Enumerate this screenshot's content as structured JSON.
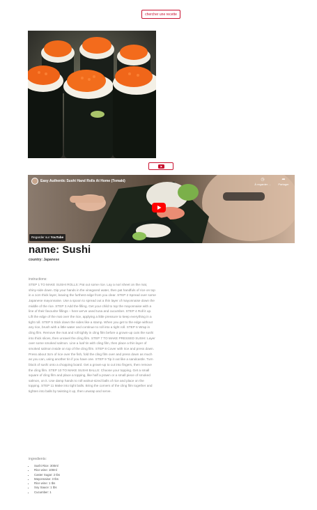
{
  "search_button": {
    "label": "chercher une recette"
  },
  "photo": {
    "alt": "Sushi"
  },
  "video": {
    "title": "Easy Authentic Sushi Hand Rolls At Home (Temaki)",
    "watch_later": "À regarder ...",
    "share": "Partager",
    "watch_on": "Regarder sur",
    "platform": "YouTube"
  },
  "recipe": {
    "name": "name: Sushi",
    "country": "country: Japanese",
    "instructions_label": "instructions:",
    "instructions": "STEP 1 TO MAKE SUSHI ROLLS: Pat out some rice. Lay a nori sheet on the mat, shiny-side down. Dip your hands in the vinegared water, then pat handfuls of rice on top in a 1cm thick layer, leaving the furthest edge from you clear. STEP 2 Spread over some Japanese mayonnaise. Use a spoon to spread out a thin layer of mayonnaise down the middle of the rice. STEP 3 Add the filling. Get your child to top the mayonnaise with a line of their favourite fillings – here we've used tuna and cucumber. STEP 4 Roll it up. Lift the edge of the mat over the rice, applying a little pressure to keep everything in a tight roll. STEP 5 Stick down the sides like a stamp. When you get to the edge without any rice, brush with a little water and continue to roll into a tight roll. STEP 6 Wrap in cling film. Remove the mat and roll tightly in cling film before a grown-up cuts the sushi into thick slices, then unravel the cling film. STEP 7 TO MAKE PRESSED SUSHI: Layer over some smoked salmon. Line a loaf tin with cling film, then place a thin layer of smoked salmon inside on top of the cling film. STEP 8 Cover with rice and press down. Press about 3cm of rice over the fish, fold the cling film over and press down as much as you can, using another tin if you have one. STEP 9 Tip it out like a sandcastle. Turn block of sushi onto a chopping board. Get a grown-up to cut into fingers, then remove the cling film. STEP 10 TO MAKE SUSHI BALLS: Choose your topping. Get a small square of cling film and place a topping, like half a prawn or a small piece of smoked salmon, on it. Use damp hands to roll walnut-sized balls of rice and place on the topping. STEP 11 Make into tight balls. Bring the corners of the cling film together and tighten into balls by twisting it up, then unwrap and serve.",
    "ingredients_label": "ingredients:",
    "ingredients": [
      "Sushi Rice: 300ml",
      "Rice wine: 100ml",
      "Caster Sugar: 2 tbs",
      "Mayonnaise: 3 tbs",
      "Rice wine: 1 tbs",
      "Soy Sauce: 1 tbs",
      "Cucumber: 1"
    ]
  },
  "colors": {
    "accent": "#c8102e",
    "youtube_red": "#ff0000"
  }
}
